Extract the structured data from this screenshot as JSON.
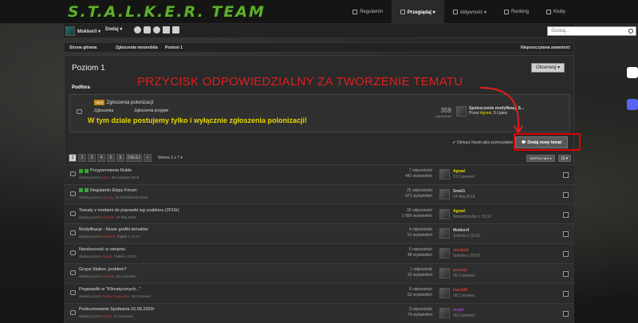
{
  "site": {
    "logo": "S.T.A.L.K.E.R. TEAM"
  },
  "nav": [
    {
      "label": "Regulamin"
    },
    {
      "label": "Przeglądaj ▾"
    },
    {
      "label": "Aktywność ▾"
    },
    {
      "label": "Ranking"
    },
    {
      "label": "Kluby"
    }
  ],
  "userbar": {
    "username": "Mokkeril ▾",
    "add": "Dodaj ▾",
    "search_placeholder": "Szukaj..."
  },
  "breadcrumb": {
    "b1": "Strona główna",
    "b2": "Zgłoszenia moonobita",
    "b3": "Poziom 1",
    "unread": "Nieprzeczytana zawartość"
  },
  "page": {
    "title": "Poziom 1",
    "observe": "Obserwuj ▾",
    "section": "Podfora"
  },
  "subforum": {
    "badge": "NEW",
    "name": "Zgłoszenia polonizacji",
    "subs": [
      "Zgłoszenia",
      "Zgłoszenia przyjęte"
    ],
    "desc": "W tym dziale postujemy tylko i wyłącznie zgłoszenia polonizacji!",
    "count": "359",
    "count_label": "odpowiedzi",
    "last_title": "Spolszczenie modyfikacji S...",
    "last_by": "Przez",
    "last_user": "Agrael",
    "last_date": ", 5 Lipiec"
  },
  "annotation": "PRZYCISK ODPOWIEDZIALNY ZA TWORZENIE TEMATU",
  "actions": {
    "mark_read": "✔ Oznacz forum jako przeczytane",
    "new_topic": "Dodaj nowy temat"
  },
  "pager": {
    "pages": [
      "1",
      "2",
      "3",
      "4",
      "5",
      "6"
    ],
    "next": "DALEJ",
    "dd": "»",
    "strona": "Strona 1 z 7 ▾",
    "sort": "SORTUJ WG ▾",
    "filter": "⊡ ▾"
  },
  "topics": [
    {
      "title": "Przypomnienie Ruble",
      "meta": "dodany przez",
      "author": "Aven",
      "date": ", 25 Listopad 2013",
      "replies": "7 odpowiedzi",
      "views": "442 wyświetleń",
      "last_user": "Agrael",
      "last_date": "13 Czerwiec",
      "last_color": "#e8d800"
    },
    {
      "title": "Regulamin Ekipy Forum",
      "meta": "dodany przez",
      "author": "pornaly",
      "date": ", 23 Październik 2015",
      "replies": "25 odpowiedzi",
      "views": "471 wyświetleń",
      "last_user": "Snatt1",
      "last_date": "24 Maj 2018",
      "last_color": "#ccc"
    },
    {
      "title": "Tematy z modami do poprawki wg szablonu (2019r)",
      "meta": "dodany przez",
      "author": "Ivan186",
      "date": ", 27 Maj 2019",
      "replies": "32 odpowiedzi",
      "views": "1 056 wyświetleń",
      "last_user": "Agrael",
      "last_date": "Nowodzonów o 15:16",
      "last_color": "#e8d800"
    },
    {
      "title": "Modyfikacje - Nowe grafiki tematów",
      "meta": "dodany przez",
      "author": "Mokkeril",
      "date": ", Piątek o 12:27",
      "replies": "4 odpowiedzi",
      "views": "51 wyświetleń",
      "last_user": "Mokkeril",
      "last_date": "Sobota o 15:02",
      "last_color": "#ccc"
    },
    {
      "title": "Nieobecność w sierpniu",
      "meta": "dodany przez",
      "author": "Agrael",
      "date": ", Piątek o 20:51",
      "replies": "5 odpowiedzi",
      "views": "48 wyświetleń",
      "last_user": "moobob",
      "last_date": "Sobota o 20:03",
      "last_color": "#c04040"
    },
    {
      "title": "Grupa Stalker, problem?",
      "meta": "dodany przez",
      "author": "Ivan186",
      "date": ", 26 Czerwiec",
      "replies": "1 odpowiedź",
      "views": "32 wyświetleń",
      "last_user": "pornaly",
      "last_date": "26 Czerwiec",
      "last_color": "#c04040"
    },
    {
      "title": "Pogawędki w \"Klimatycznych...\"",
      "meta": "dodany przez",
      "author": "Stefan Gawenicki",
      "date": ", 28 Czerwiec",
      "replies": "8 odpowiedzi",
      "views": "53 wyświetleń",
      "last_user": "Ivan186",
      "last_date": "28 Czerwiec",
      "last_color": "#c04040"
    },
    {
      "title": "Podsumowanie Spotkania 16.06.2020r",
      "meta": "dodany przez",
      "author": "Agrael",
      "date": ", 17 Czerwiec",
      "replies": "3 odpowiedzi",
      "views": "74 wyświetleń",
      "last_user": "mobil",
      "last_date": "20 Czerwiec",
      "last_color": "#a040d0"
    }
  ]
}
